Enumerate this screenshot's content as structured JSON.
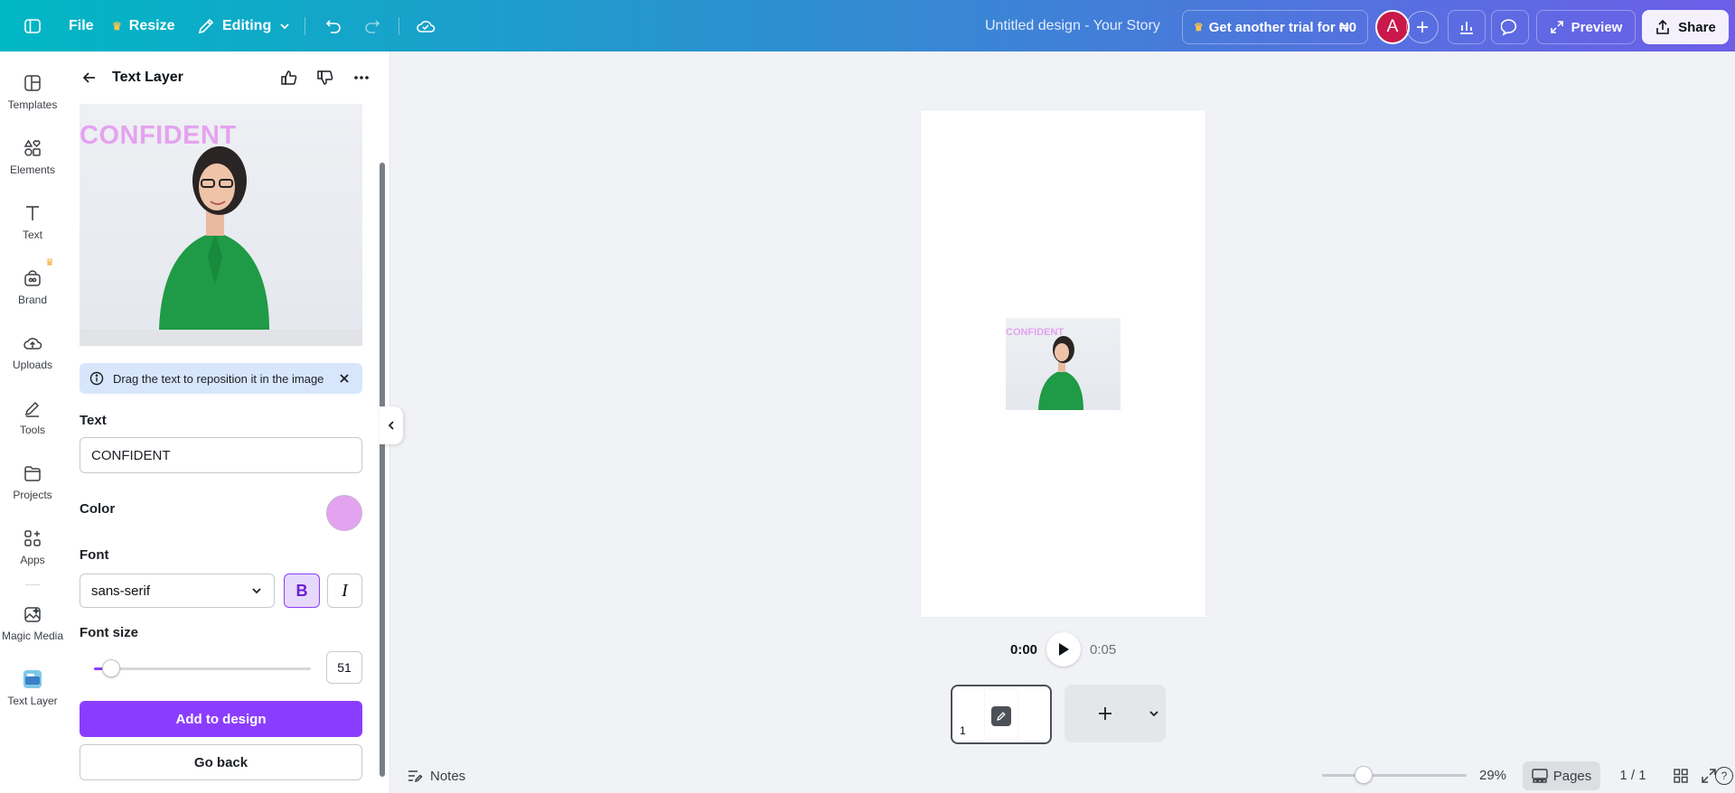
{
  "topbar": {
    "file_label": "File",
    "resize_label": "Resize",
    "editing_label": "Editing",
    "design_title": "Untitled design - Your Story",
    "trial_label": "Get another trial for ₦0",
    "avatar_initial": "A",
    "preview_label": "Preview",
    "share_label": "Share",
    "gradient_start": "#00b7c4",
    "gradient_end": "#6d5ee8"
  },
  "rail": {
    "items": [
      {
        "label": "Templates",
        "icon": "templates-icon"
      },
      {
        "label": "Elements",
        "icon": "elements-icon"
      },
      {
        "label": "Text",
        "icon": "text-icon"
      },
      {
        "label": "Brand",
        "icon": "brand-icon"
      },
      {
        "label": "Uploads",
        "icon": "uploads-icon"
      },
      {
        "label": "Tools",
        "icon": "tools-icon"
      },
      {
        "label": "Projects",
        "icon": "projects-icon"
      },
      {
        "label": "Apps",
        "icon": "apps-icon"
      },
      {
        "label": "Magic Media",
        "icon": "magic-media-icon"
      },
      {
        "label": "Text Layer",
        "icon": "text-layer-app-icon"
      }
    ]
  },
  "panel": {
    "title": "Text Layer",
    "preview_text": "CONFIDENT",
    "info_message": "Drag the text to reposition it in the image",
    "text_section_label": "Text",
    "text_value": "CONFIDENT",
    "color_section_label": "Color",
    "color_value": "#e4a3ef",
    "font_section_label": "Font",
    "font_value": "sans-serif",
    "bold_label": "B",
    "italic_label": "I",
    "font_size_label": "Font size",
    "font_size_value": "51",
    "font_size_fraction": 0.08,
    "add_button_label": "Add to design",
    "go_back_label": "Go back",
    "accent_color": "#8b3dff"
  },
  "canvas": {
    "page_text": "CONFIDENT",
    "time_current": "0:00",
    "time_total": "0:05",
    "page_number": "1"
  },
  "bottombar": {
    "notes_label": "Notes",
    "zoom_value": "29%",
    "zoom_fraction": 0.29,
    "pages_label": "Pages",
    "page_count": "1 / 1",
    "help_label": "?"
  }
}
